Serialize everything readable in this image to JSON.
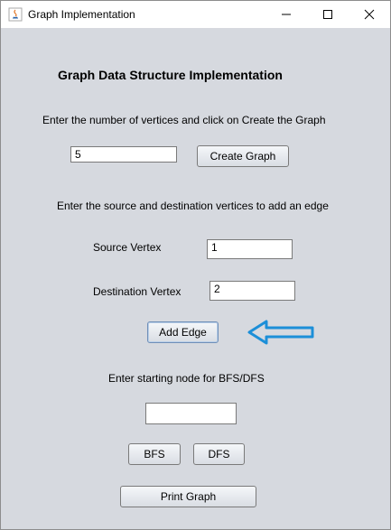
{
  "window": {
    "title": "Graph Implementation",
    "controls": {
      "minimize": "─",
      "maximize": "☐",
      "close": "✕"
    }
  },
  "main": {
    "heading": "Graph Data Structure Implementation",
    "vertices_prompt": "Enter the number of vertices and click on Create the Graph",
    "vertices_value": "5",
    "create_graph_label": "Create Graph",
    "edge_prompt": "Enter the source and destination vertices to add an edge",
    "source_label": "Source Vertex",
    "source_value": "1",
    "destination_label": "Destination Vertex",
    "destination_value": "2",
    "add_edge_label": "Add Edge",
    "start_prompt": "Enter starting node for BFS/DFS",
    "start_value": "",
    "bfs_label": "BFS",
    "dfs_label": "DFS",
    "print_graph_label": "Print Graph"
  },
  "annotation": {
    "arrow_color": "#1c8fd8"
  }
}
